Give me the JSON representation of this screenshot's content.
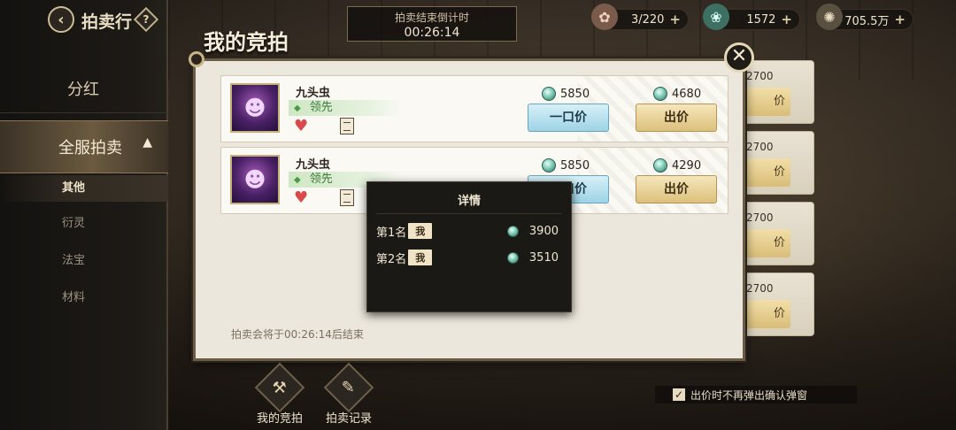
{
  "header": {
    "title": "拍卖行",
    "help": "?",
    "countdown_label": "拍卖结束倒计时",
    "countdown_value": "00:26:14",
    "resources": [
      {
        "icon": "stamina-icon",
        "value": "3/220",
        "plus": "+"
      },
      {
        "icon": "jade-gem-icon",
        "value": "1572",
        "plus": "+"
      },
      {
        "icon": "coin-icon",
        "value": "705.5万",
        "plus": "+"
      }
    ]
  },
  "sidebar": {
    "dividend": "分红",
    "server_auction": "全服拍卖",
    "sub_items": [
      "其他",
      "衍灵",
      "法宝",
      "材料"
    ],
    "selected_sub": 0
  },
  "background_cards": [
    {
      "amount": "2700",
      "bid": "价"
    },
    {
      "amount": "2700",
      "bid": "价"
    },
    {
      "amount": "2700",
      "bid": "价"
    },
    {
      "amount": "2700",
      "bid": "价"
    },
    {
      "amount": "2700",
      "bid": "价"
    }
  ],
  "panel": {
    "title": "我的竞拍",
    "end_note": "拍卖会将于00:26:14后结束",
    "rows": [
      {
        "name": "九头虫",
        "status": "领先",
        "buyout_price": "5850",
        "bid_price": "4680",
        "buyout_label": "一口价",
        "bid_label": "出价"
      },
      {
        "name": "九头虫",
        "status": "领先",
        "buyout_price": "5850",
        "bid_price": "4290",
        "buyout_label": "一口价",
        "bid_label": "出价"
      }
    ]
  },
  "details": {
    "title": "详情",
    "ranks": [
      {
        "rank": "第1名",
        "who": "我",
        "amount": "3900"
      },
      {
        "rank": "第2名",
        "who": "我",
        "amount": "3510"
      }
    ]
  },
  "bottom": {
    "my_bids": "我的竞拍",
    "records": "拍卖记录",
    "confirm_option": "出价时不再弹出确认弹窗",
    "confirm_checked": "✓"
  },
  "colors": {
    "accent_gold": "#dcc07c",
    "buyout_blue": "#9dd3e6",
    "lead_green": "#3c7a37"
  }
}
